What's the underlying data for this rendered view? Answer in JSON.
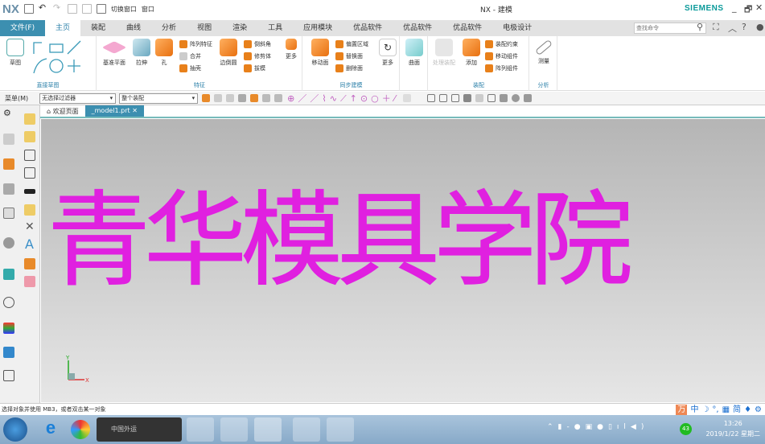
{
  "titlebar": {
    "logo": "NX",
    "switch_window": "切换窗口",
    "window": "窗口",
    "title": "NX - 建模",
    "brand": "SIEMENS",
    "minimize": "_",
    "restore": "🗗",
    "close": "✕"
  },
  "menubar": {
    "tabs": [
      "文件(F)",
      "主页",
      "装配",
      "曲线",
      "分析",
      "视图",
      "渲染",
      "工具",
      "应用模块",
      "优品软件",
      "优品软件",
      "优品软件",
      "电极设计"
    ],
    "active": "主页",
    "search_placeholder": "查找命令"
  },
  "ribbon": {
    "sketch": {
      "label": "草图",
      "group": "直接草图"
    },
    "feature": {
      "datum": "基准平面",
      "extrude": "拉伸",
      "hole": "孔",
      "pattern": "阵列特征",
      "unite": "合并",
      "shell": "抽壳",
      "edge_blend": "边倒圆",
      "chamfer": "倒斜角",
      "trim_body": "修剪体",
      "draft": "拔模",
      "more": "更多",
      "group": "特征"
    },
    "sync": {
      "move_face": "移动面",
      "offset_region": "偏置区域",
      "replace_face": "替换面",
      "delete_face": "删除面",
      "more": "更多",
      "group": "同步建模"
    },
    "surface": {
      "label": "曲面"
    },
    "assembly": {
      "assembly_nav": "处理装配",
      "add": "添加",
      "constraint": "装配约束",
      "move_comp": "移动组件",
      "pattern_comp": "阵列组件",
      "group": "装配"
    },
    "analysis": {
      "measure": "测量",
      "group": "分析"
    }
  },
  "toolbar": {
    "menu": "菜单(M)",
    "filter": "无选择过滤器",
    "scope": "整个装配"
  },
  "doctabs": [
    {
      "label": "欢迎页面"
    },
    {
      "label": "_model1.prt"
    }
  ],
  "viewport": {
    "text": "青华模具学院",
    "text_color": "#e020e0",
    "axis_x": "X",
    "axis_y": "Y"
  },
  "status": {
    "message": "选择对象并使用 MB3，或者双击某一对象",
    "ime": [
      "中",
      "简"
    ]
  },
  "taskbar": {
    "search": "中国外运",
    "badge": "43",
    "time": "13:26",
    "date": "2019/1/22 星期二"
  }
}
